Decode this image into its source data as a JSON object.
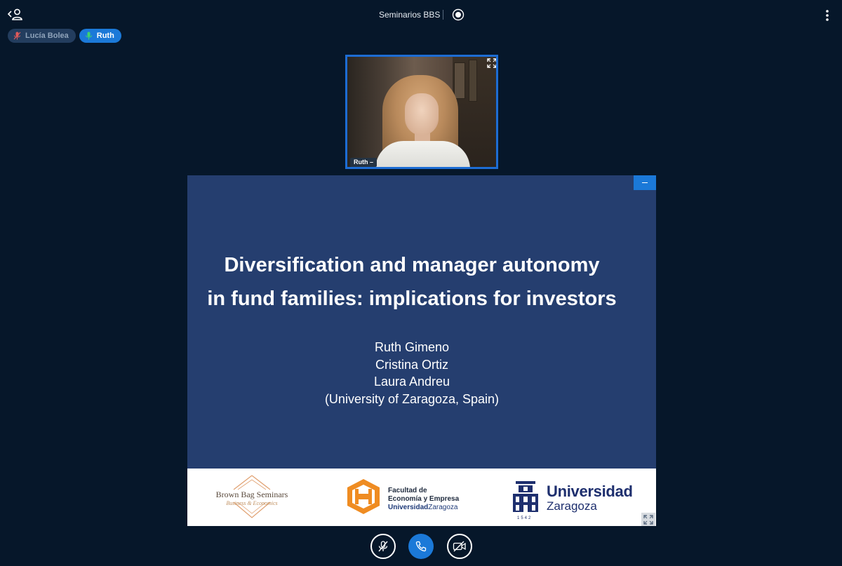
{
  "header": {
    "meeting_title": "Seminarios BBS",
    "users_icon": "users-toggle-icon",
    "record_icon": "record-icon",
    "options_icon": "more-vertical-icon"
  },
  "talkers": [
    {
      "name": "Lucía Bolea",
      "state": "muted",
      "icon": "mic-muted-icon"
    },
    {
      "name": "Ruth",
      "state": "talking",
      "icon": "mic-icon"
    }
  ],
  "webcam": {
    "user_label": "Ruth",
    "label_suffix": "–"
  },
  "slide": {
    "title_line1": "Diversification and manager autonomy",
    "title_line2": "in fund families: implications for investors",
    "authors": [
      "Ruth Gimeno",
      "Cristina Ortiz",
      "Laura Andreu"
    ],
    "affiliation": "(University of Zaragoza, Spain)",
    "logos": {
      "bbs_title": "Brown Bag Seminars",
      "bbs_subtitle": "Business & Economics",
      "fac_line1": "Facultad de",
      "fac_line2": "Economía y Empresa",
      "fac_line3a": "Universidad",
      "fac_line3b": "Zaragoza",
      "uz_line1": "Universidad",
      "uz_line2": "Zaragoza",
      "uz_year": "1542"
    }
  },
  "colors": {
    "background": "#06172a",
    "accent": "#1b79d8",
    "slide_bg": "#253e6f"
  }
}
